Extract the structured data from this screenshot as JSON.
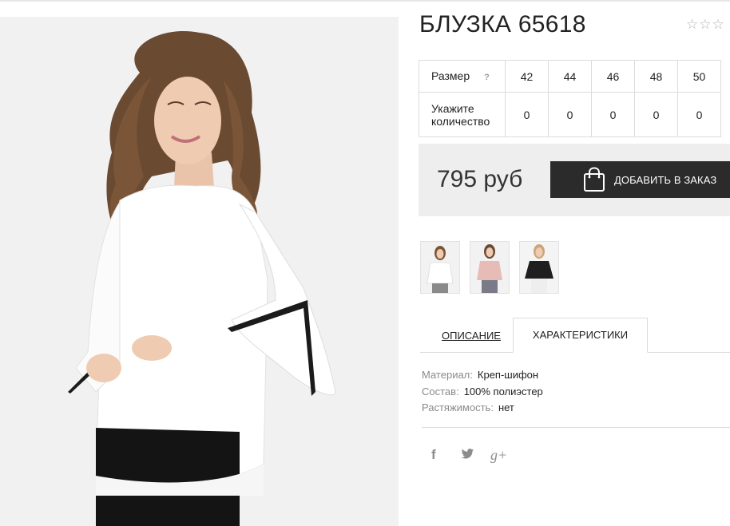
{
  "product": {
    "title": "БЛУЗКА 65618",
    "rating": {
      "value": 0,
      "max": 3
    }
  },
  "size_table": {
    "size_label": "Размер",
    "help_glyph": "?",
    "sizes": [
      "42",
      "44",
      "46",
      "48",
      "50"
    ],
    "quantity_label_line1": "Укажите",
    "quantity_label_line2": "количество",
    "quantities": [
      "0",
      "0",
      "0",
      "0",
      "0"
    ]
  },
  "price": {
    "value": "795 руб"
  },
  "order": {
    "button_label": "ДОБАВИТЬ В ЗАКАЗ",
    "icon": "shopping-bag-icon"
  },
  "thumbnails": [
    {
      "name": "white-blouse-thumbnail",
      "top_color": "#f4f4f4"
    },
    {
      "name": "pink-blouse-thumbnail",
      "top_color": "#e8bcb6"
    },
    {
      "name": "black-blouse-thumbnail",
      "top_color": "#1f1f1f"
    }
  ],
  "tabs": {
    "description": "ОПИСАНИЕ",
    "characteristics": "ХАРАКТЕРИСТИКИ",
    "active": "characteristics"
  },
  "specs": [
    {
      "key": "Материал:",
      "value": "Креп-шифон"
    },
    {
      "key": "Состав:",
      "value": "100% полиэстер"
    },
    {
      "key": "Растяжимость:",
      "value": "нет"
    }
  ],
  "social": {
    "facebook": "f",
    "twitter": "twitter-icon",
    "googleplus": "g+"
  },
  "colors": {
    "button_bg": "#2b2b2b",
    "price_bg": "#eeeeee",
    "border": "#dcdcdc"
  }
}
